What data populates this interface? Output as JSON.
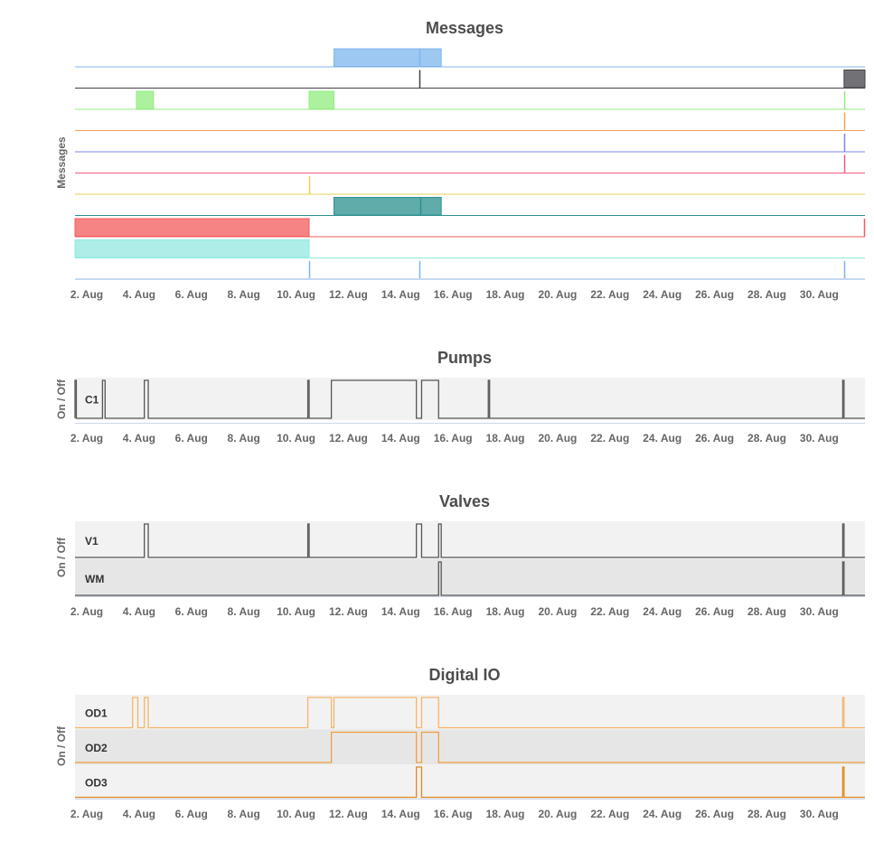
{
  "x_axis": {
    "min_day": 1.55,
    "max_day": 31.75,
    "month": "Aug",
    "ticks": [
      "2. Aug",
      "4. Aug",
      "6. Aug",
      "8. Aug",
      "10. Aug",
      "12. Aug",
      "14. Aug",
      "16. Aug",
      "18. Aug",
      "20. Aug",
      "22. Aug",
      "24. Aug",
      "26. Aug",
      "28. Aug",
      "30. Aug"
    ],
    "tick_days": [
      2,
      4,
      6,
      8,
      10,
      12,
      14,
      16,
      18,
      20,
      22,
      24,
      26,
      28,
      30
    ]
  },
  "chart_data": [
    {
      "type": "timeline",
      "title": "Messages",
      "ylabel": "Messages",
      "series": [
        {
          "color": "#7cb5ec",
          "segments": [
            [
              11.45,
              15.55
            ]
          ],
          "spikes": [
            14.7
          ]
        },
        {
          "color": "#434348",
          "segments": [
            [
              30.95,
              31.75
            ]
          ],
          "spikes": [
            14.7
          ]
        },
        {
          "color": "#90ed7d",
          "segments": [
            [
              3.9,
              4.55
            ],
            [
              10.5,
              11.45
            ]
          ],
          "spikes": [
            30.95
          ]
        },
        {
          "color": "#f7a35c",
          "segments": [],
          "spikes": [
            30.95
          ]
        },
        {
          "color": "#8085e9",
          "segments": [],
          "spikes": [
            30.95
          ]
        },
        {
          "color": "#f15c80",
          "segments": [],
          "spikes": [
            30.95
          ]
        },
        {
          "color": "#e4d354",
          "segments": [],
          "spikes": [
            10.5
          ]
        },
        {
          "color": "#2b908f",
          "segments": [
            [
              11.45,
              15.55
            ]
          ],
          "spikes": [
            14.75
          ]
        },
        {
          "color": "#f45b5b",
          "segments": [
            [
              1.55,
              10.5
            ]
          ],
          "spikes": [
            31.7
          ]
        },
        {
          "color": "#91e8e1",
          "segments": [
            [
              1.55,
              10.5
            ]
          ],
          "spikes": []
        },
        {
          "color": "#7cb5ec",
          "segments": [],
          "spikes": [
            10.5,
            14.7,
            30.95
          ]
        }
      ]
    },
    {
      "type": "step",
      "title": "Pumps",
      "ylabel": "On / Off",
      "line_color": "#555555",
      "series": [
        {
          "name": "C1",
          "on": [
            [
              1.55,
              1.6
            ],
            [
              2.6,
              2.7
            ],
            [
              4.2,
              4.35
            ],
            [
              10.45,
              10.5
            ],
            [
              11.35,
              14.6
            ],
            [
              14.8,
              15.45
            ],
            [
              17.35,
              17.4
            ],
            [
              30.9,
              30.95
            ]
          ]
        }
      ]
    },
    {
      "type": "step",
      "title": "Valves",
      "ylabel": "On / Off",
      "line_color": "#555555",
      "series": [
        {
          "name": "V1",
          "on": [
            [
              4.2,
              4.35
            ],
            [
              10.45,
              10.5
            ],
            [
              14.6,
              14.8
            ],
            [
              15.45,
              15.55
            ],
            [
              30.9,
              30.95
            ]
          ]
        },
        {
          "name": "WM",
          "on": [
            [
              15.45,
              15.55
            ],
            [
              30.9,
              30.95
            ]
          ]
        }
      ]
    },
    {
      "type": "step",
      "title": "Digital IO",
      "ylabel": "On / Off",
      "series": [
        {
          "name": "OD1",
          "color": "#f7b46a",
          "on": [
            [
              3.75,
              3.95
            ],
            [
              4.2,
              4.35
            ],
            [
              10.45,
              11.35
            ],
            [
              11.45,
              14.6
            ],
            [
              14.8,
              15.45
            ],
            [
              30.9,
              30.95
            ]
          ]
        },
        {
          "name": "OD2",
          "color": "#f0a040",
          "on": [
            [
              11.35,
              14.6
            ],
            [
              14.8,
              15.45
            ]
          ]
        },
        {
          "name": "OD3",
          "color": "#e08a1e",
          "on": [
            [
              14.6,
              14.8
            ],
            [
              30.9,
              30.95
            ]
          ]
        }
      ]
    }
  ]
}
